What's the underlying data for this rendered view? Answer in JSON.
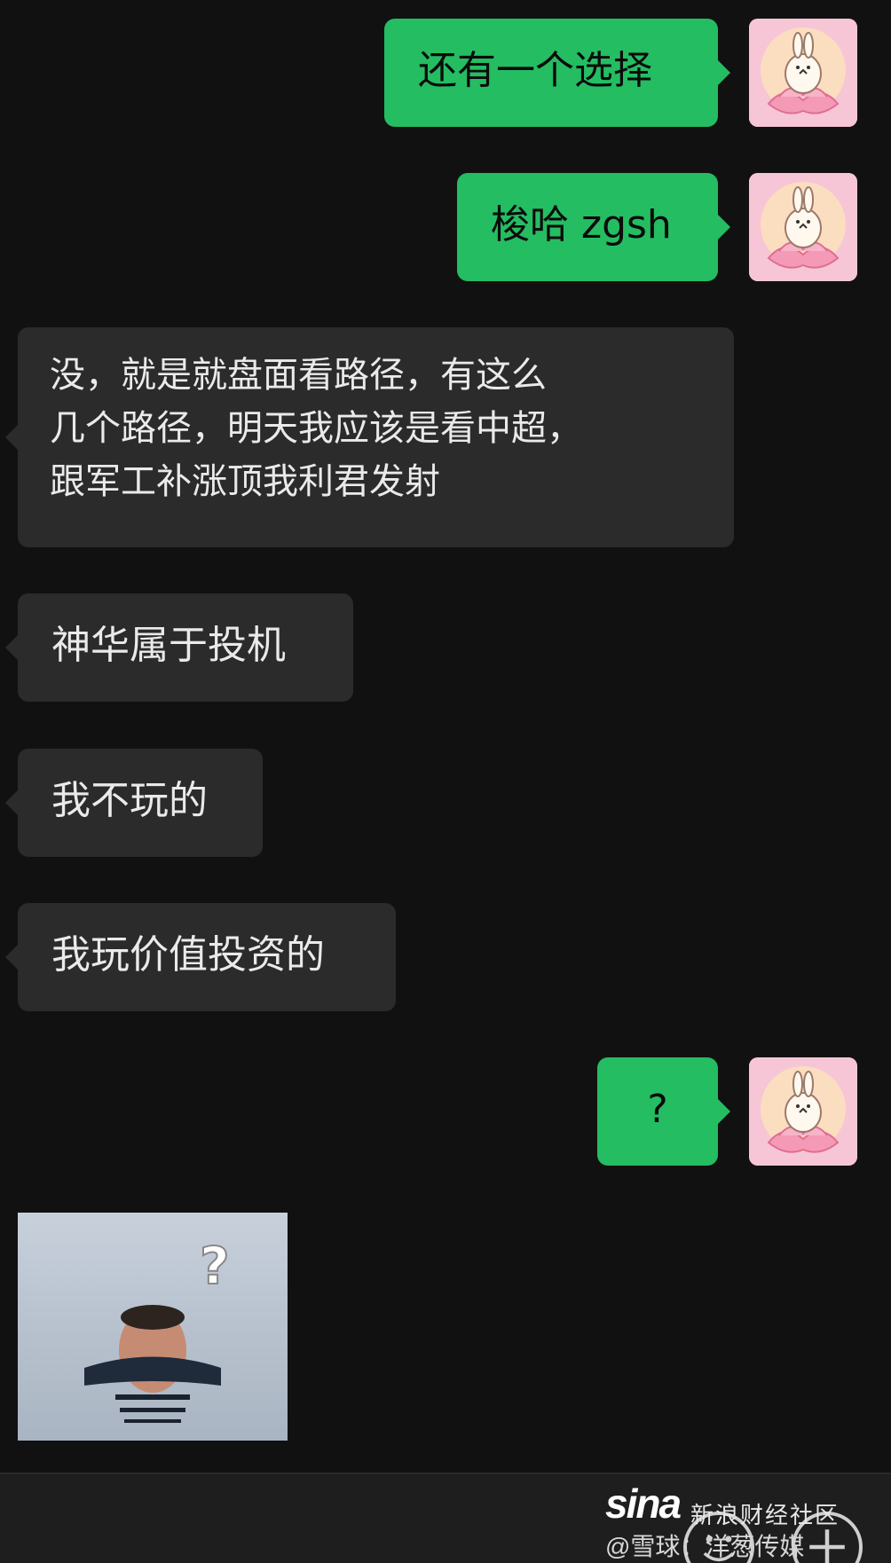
{
  "messages": [
    {
      "side": "out",
      "text": "还有一个选择"
    },
    {
      "side": "out",
      "text": "梭哈 zgsh"
    },
    {
      "side": "in",
      "text": "没，就是就盘面看路径，有这么\n几个路径，明天我应该是看中超，\n跟军工补涨顶我利君发射"
    },
    {
      "side": "in",
      "text": "神华属于投机"
    },
    {
      "side": "in",
      "text": "我不玩的"
    },
    {
      "side": "in",
      "text": "我玩价值投资的"
    },
    {
      "side": "out",
      "text": "?"
    }
  ],
  "sticker": {
    "overlay_text": "?"
  },
  "avatar": {
    "icon": "rabbit-on-lotus-icon"
  },
  "bottom_bar": {
    "icons": [
      "emoji-icon",
      "plus-icon"
    ]
  },
  "watermark": {
    "logo": "sina",
    "line1": "新浪财经社区",
    "line2": "@雪球：洋葱传媒"
  },
  "colors": {
    "background": "#111111",
    "outgoing": "#24bd62",
    "incoming": "#2b2b2b"
  }
}
